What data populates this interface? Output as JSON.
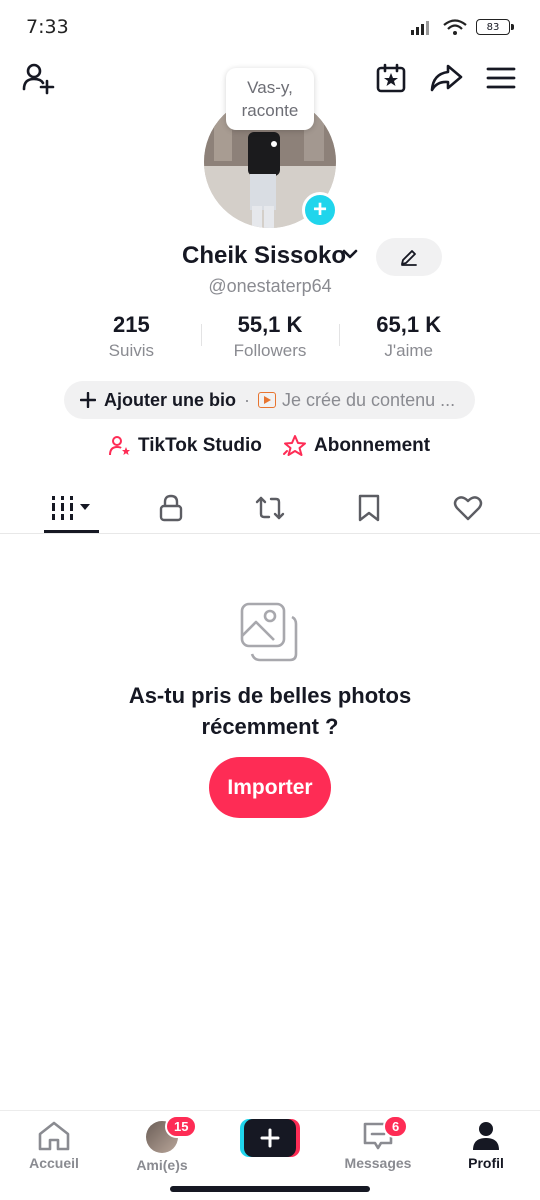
{
  "status": {
    "time": "7:33",
    "battery": "83"
  },
  "profile": {
    "bubble_text": "Vas-y, raconte",
    "name": "Cheik Sissoko",
    "handle": "@onestaterp64"
  },
  "stats": [
    {
      "value": "215",
      "label": "Suivis"
    },
    {
      "value": "55,1 K",
      "label": "Followers"
    },
    {
      "value": "65,1 K",
      "label": "J'aime"
    }
  ],
  "bio": {
    "add_label": "Ajouter une bio",
    "separator": "·",
    "content_label": "Je crée du contenu ..."
  },
  "links": {
    "studio": "TikTok Studio",
    "subscription": "Abonnement"
  },
  "empty_state": {
    "title": "As-tu pris de belles photos récemment ?",
    "button": "Importer"
  },
  "bottom_nav": {
    "home": "Accueil",
    "friends": "Ami(e)s",
    "friends_badge": "15",
    "messages": "Messages",
    "messages_badge": "6",
    "profile": "Profil"
  },
  "colors": {
    "accent": "#fe2c55",
    "cyan": "#20d5ec",
    "text": "#161823",
    "muted": "#8a8b91"
  }
}
